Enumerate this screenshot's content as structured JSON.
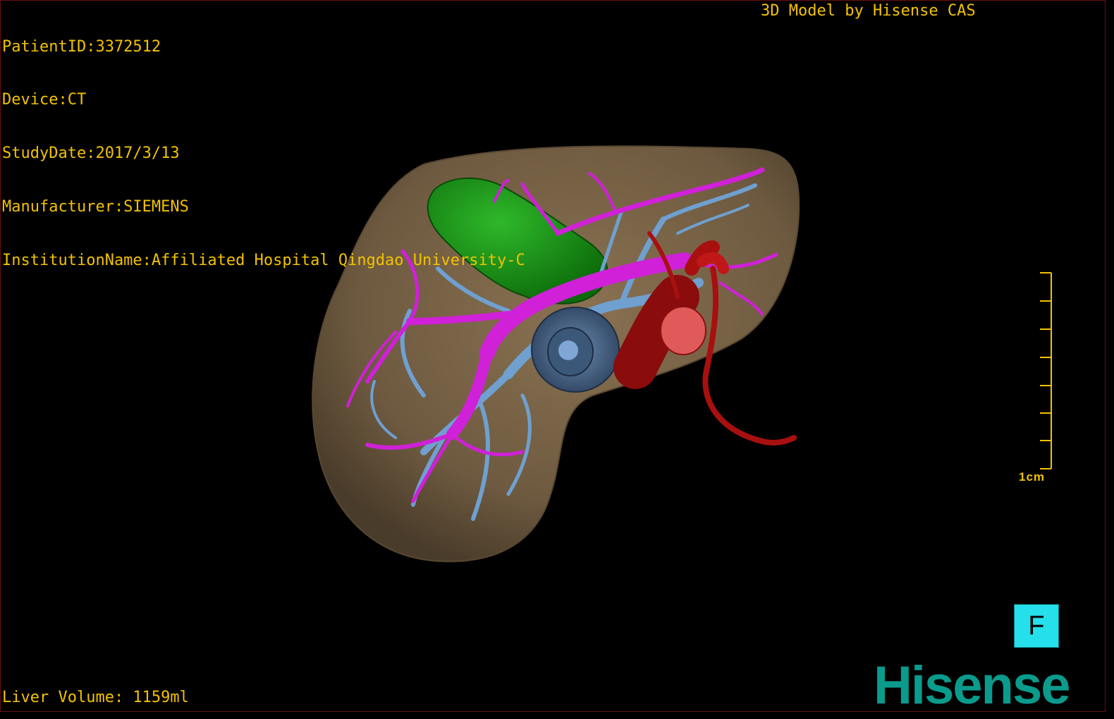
{
  "overlay": {
    "patient_id": "PatientID:3372512",
    "device": "Device:CT",
    "study_date": "StudyDate:2017/3/13",
    "manufacturer": "Manufacturer:SIEMENS",
    "institution": "InstitutionName:Affiliated Hospital Qingdao University-C",
    "model_label": "3D Model by Hisense CAS",
    "liver_volume": "Liver Volume: 1159ml"
  },
  "scale_bar": {
    "label": "1cm",
    "tick_count": 8
  },
  "orientation": {
    "label": "F"
  },
  "brand": {
    "name": "Hisense"
  },
  "colors": {
    "overlay_text": "#f2c200",
    "liver": "#7a6448",
    "tumor": "#1a8a14",
    "portal_vein": "#d020d8",
    "hepatic_vein": "#6fa0d0",
    "artery": "#a81010",
    "orientation_bg": "#25e0ea",
    "brand": "#0a9b8c"
  }
}
